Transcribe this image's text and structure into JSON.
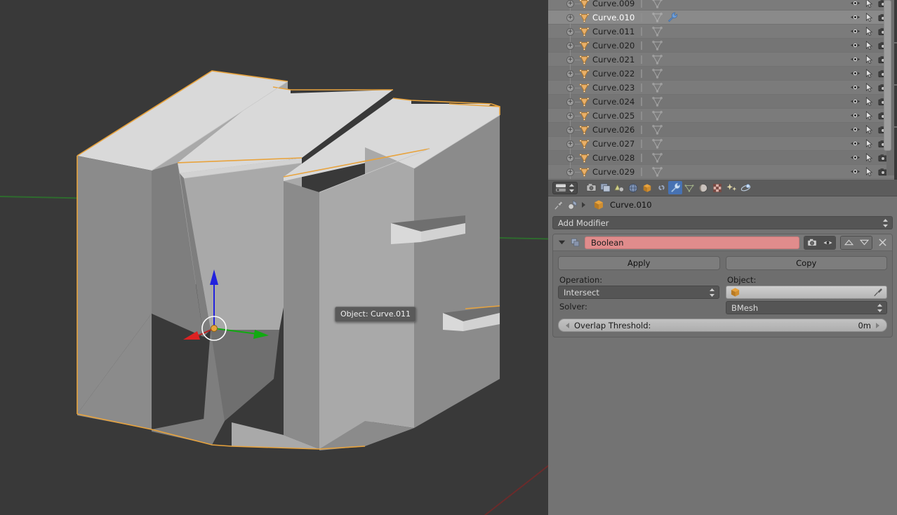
{
  "app": {
    "name": "Blender",
    "theme": "default-dark-gray"
  },
  "viewport": {
    "name": "3d-viewport",
    "tooltip": "Object: Curve.011",
    "background_color": "#393939",
    "object_fill_top": "#d8d8d8",
    "object_fill_side": "#8b8b8b",
    "object_fill_dark": "#6e6e6e",
    "selection_outline_color": "#e8a33d",
    "axis_x_color": "#6b2b2b",
    "axis_y_color": "#2e6b2e",
    "axis_z_color": "#2222cc",
    "manipulator": {
      "x_axis_color": "#dd2222",
      "y_axis_color": "#22bb22",
      "z_axis_color": "#2222dd",
      "origin_color": "#e8a33d"
    }
  },
  "outliner": {
    "name": "outliner-editor",
    "selected_item": "Curve.010",
    "restrict_icons": [
      "eye-icon",
      "cursor-arrow-icon",
      "camera-icon"
    ],
    "items": [
      {
        "label": "Curve.009",
        "selected": false,
        "has_modifier": false
      },
      {
        "label": "Curve.010",
        "selected": true,
        "has_modifier": true
      },
      {
        "label": "Curve.011",
        "selected": false,
        "has_modifier": false
      },
      {
        "label": "Curve.020",
        "selected": false,
        "has_modifier": false
      },
      {
        "label": "Curve.021",
        "selected": false,
        "has_modifier": false
      },
      {
        "label": "Curve.022",
        "selected": false,
        "has_modifier": false
      },
      {
        "label": "Curve.023",
        "selected": false,
        "has_modifier": false
      },
      {
        "label": "Curve.024",
        "selected": false,
        "has_modifier": false
      },
      {
        "label": "Curve.025",
        "selected": false,
        "has_modifier": false
      },
      {
        "label": "Curve.026",
        "selected": false,
        "has_modifier": false
      },
      {
        "label": "Curve.027",
        "selected": false,
        "has_modifier": false
      },
      {
        "label": "Curve.028",
        "selected": false,
        "has_modifier": false
      },
      {
        "label": "Curve.029",
        "selected": false,
        "has_modifier": false
      }
    ]
  },
  "properties": {
    "name": "properties-editor",
    "editor_type_icon": "properties-editor-icon",
    "tabs": [
      {
        "name": "render",
        "icon": "camera-back-icon",
        "active": false
      },
      {
        "name": "scene",
        "icon": "photos-icon",
        "active": false
      },
      {
        "name": "scene-props",
        "icon": "cone-sphere-icon",
        "active": false
      },
      {
        "name": "world",
        "icon": "globe-icon",
        "active": false
      },
      {
        "name": "object",
        "icon": "cube-icon",
        "active": false
      },
      {
        "name": "constraints",
        "icon": "chain-icon",
        "active": false
      },
      {
        "name": "modifiers",
        "icon": "wrench-icon",
        "active": true
      },
      {
        "name": "object-data",
        "icon": "curve-data-icon",
        "active": false
      },
      {
        "name": "material",
        "icon": "sphere-icon",
        "active": false
      },
      {
        "name": "texture",
        "icon": "checker-icon",
        "active": false
      },
      {
        "name": "particles",
        "icon": "sparkles-icon",
        "active": false
      },
      {
        "name": "physics",
        "icon": "orbit-icon",
        "active": false
      }
    ],
    "breadcrumb": {
      "pin_icon": "pin-icon",
      "scene_icon": "scene-icon",
      "separator": "▸",
      "object_icon": "cube-icon",
      "object_name": "Curve.010"
    },
    "add_modifier_label": "Add Modifier",
    "modifier": {
      "name_value": "Boolean",
      "name_field_color": "#e08c8c",
      "collapse_icon": "chevron-down-icon",
      "copy_icon": "duplicate-icon",
      "render_toggle_icon": "camera-icon",
      "realtime_toggle_icon": "eye-icon",
      "move_up_icon": "chevron-up-icon",
      "move_down_icon": "chevron-down-icon",
      "delete_icon": "close-x-icon",
      "apply_label": "Apply",
      "copy_label": "Copy",
      "operation_label": "Operation:",
      "operation_value": "Intersect",
      "object_label": "Object:",
      "object_value": "",
      "object_icon": "cube-icon",
      "eyedropper_icon": "eyedropper-icon",
      "solver_label": "Solver:",
      "solver_value": "BMesh",
      "overlap_threshold_label": "Overlap Threshold:",
      "overlap_threshold_value": "0m"
    }
  }
}
